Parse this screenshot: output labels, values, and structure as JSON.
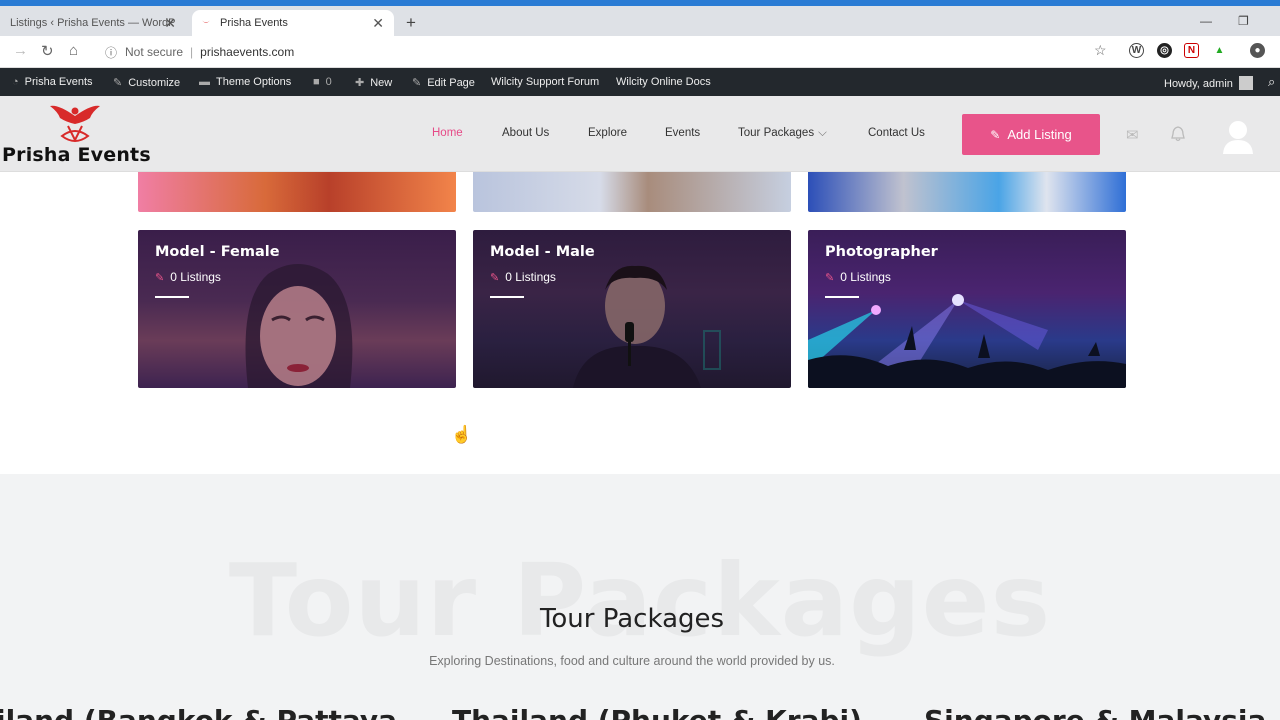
{
  "browser": {
    "tabs": [
      {
        "label": "Listings ‹ Prisha Events — WordP",
        "active": false
      },
      {
        "label": "Prisha Events",
        "active": true
      }
    ],
    "url": "prishaevents.com",
    "security": "Not secure"
  },
  "adminbar": {
    "site": "Prisha Events",
    "customize": "Customize",
    "theme_options": "Theme Options",
    "comments": "0",
    "new": "New",
    "edit_page": "Edit Page",
    "support": "Wilcity Support Forum",
    "docs": "Wilcity Online Docs",
    "howdy": "Howdy, admin"
  },
  "header": {
    "logo": "Prisha Events",
    "nav": [
      "Home",
      "About Us",
      "Explore",
      "Events",
      "Tour Packages",
      "Contact Us"
    ],
    "add_listing": "Add Listing"
  },
  "cards": [
    {
      "title": "Model - Female",
      "count": "0 Listings"
    },
    {
      "title": "Model - Male",
      "count": "0 Listings"
    },
    {
      "title": "Photographer",
      "count": "0 Listings"
    }
  ],
  "tour": {
    "bg_text": "Tour Packages",
    "title": "Tour Packages",
    "subtitle": "Exploring Destinations, food and culture around the world provided by us.",
    "packages": [
      "iland (Bangkok & Pattaya",
      "Thailand (Phuket & Krabi)",
      "Singapore & Malaysia"
    ]
  },
  "colors": {
    "accent": "#e8548a",
    "adminbar": "#23282d",
    "header_bg": "#e9e9ea"
  }
}
